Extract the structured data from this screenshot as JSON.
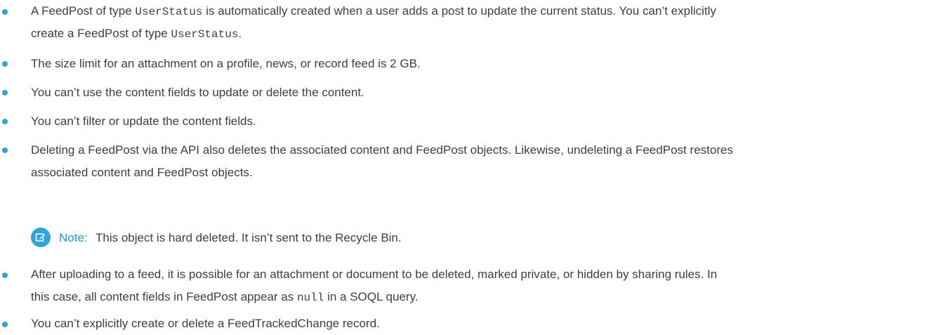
{
  "bullets": [
    {
      "line1_pre": "A FeedPost of type ",
      "line1_code": "UserStatus",
      "line1_post": " is automatically created when a user adds a post to update the current status. You can’t explicitly",
      "line2_pre": "create a FeedPost of type ",
      "line2_code": "UserStatus",
      "line2_post": "."
    },
    {
      "text": "The size limit for an attachment on a profile, news, or record feed is 2 GB."
    },
    {
      "text": "You can’t use the content fields to update or delete the content."
    },
    {
      "text": "You can’t filter or update the content fields."
    },
    {
      "line1": "Deleting a FeedPost via the API also deletes the associated content and FeedPost objects. Likewise, undeleting a FeedPost restores",
      "line2": "associated content and FeedPost objects."
    },
    {
      "line1": "After uploading to a feed, it is possible for an attachment or document to be deleted, marked private, or hidden by sharing rules. In",
      "line2_pre": "this case, all content fields in FeedPost appear as ",
      "line2_code": "null",
      "line2_post": " in a SOQL query."
    },
    {
      "text": "You can’t explicitly create or delete a FeedTrackedChange record."
    }
  ],
  "note": {
    "icon": "edit-note-icon",
    "label": "Note:",
    "text": "This object is hard deleted. It isn’t sent to the Recycle Bin."
  },
  "colors": {
    "bullet": "#2ea3dc",
    "note_label": "#1b98d4",
    "body_text": "#3e3e3c"
  }
}
